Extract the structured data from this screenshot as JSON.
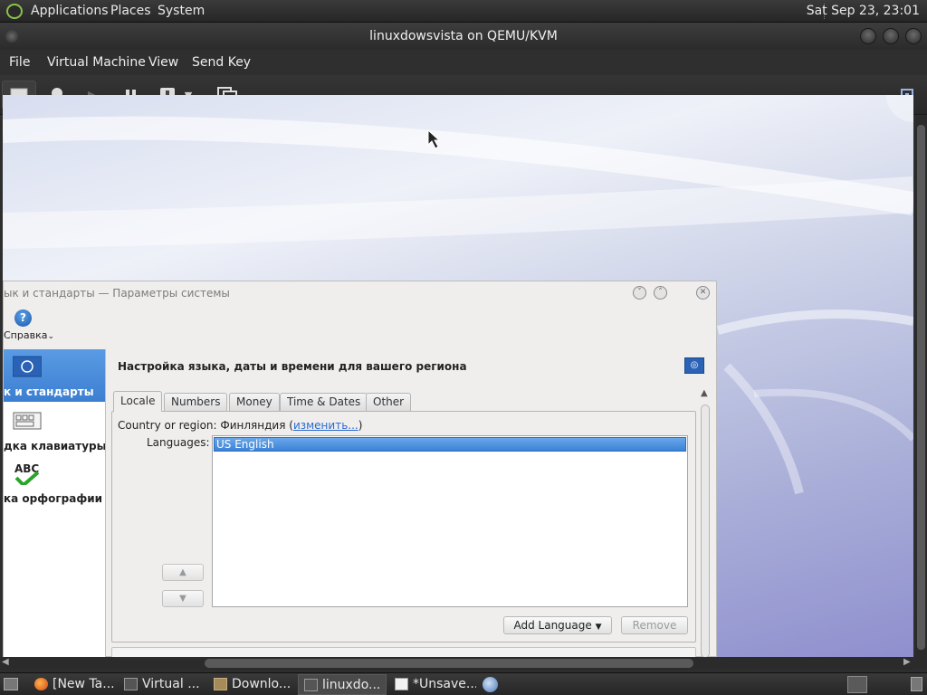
{
  "top_panel": {
    "applications": "Applications",
    "places": "Places",
    "system": "System",
    "clock": "Sat Sep 23, 23:01"
  },
  "vm_window": {
    "title": "linuxdowsvista on QEMU/KVM",
    "menu": [
      "File",
      "Virtual Machine",
      "View",
      "Send Key"
    ],
    "toolbar_icons": [
      "console-icon",
      "details-bulb-icon",
      "run-icon",
      "pause-icon",
      "shutdown-icon",
      "dropdown-icon",
      "snapshot-icon",
      "fullscreen-icon"
    ]
  },
  "kde_window": {
    "title": "ык и стандарты — Параметры системы",
    "help_label": "Справка",
    "sidebar": [
      {
        "label": "к и стандарты",
        "icon": "flag-icon",
        "selected": true
      },
      {
        "label": "дка клавиатуры",
        "icon": "keyboard-icon",
        "selected": false
      },
      {
        "label": "ка орфографии",
        "icon": "spellcheck-icon",
        "selected": false
      }
    ],
    "heading": "Настройка языка, даты и времени для вашего региона",
    "tabs": [
      "Locale",
      "Numbers",
      "Money",
      "Time & Dates",
      "Other"
    ],
    "active_tab": "Locale",
    "country_label": "Country or region:",
    "country_value": "Финляндия",
    "change_link": "изменить...",
    "languages_label": "Languages:",
    "languages": [
      "US English"
    ],
    "add_language": "Add Language",
    "remove": "Remove"
  },
  "taskbar": [
    {
      "label": "[New Ta...",
      "icon": "firefox-icon",
      "active": false
    },
    {
      "label": "Virtual ...",
      "icon": "virt-manager-icon",
      "active": false
    },
    {
      "label": "Downlo...",
      "icon": "folder-icon",
      "active": false
    },
    {
      "label": "linuxdo...",
      "icon": "vm-console-icon",
      "active": true
    },
    {
      "label": "*Unsave...",
      "icon": "text-editor-icon",
      "active": false
    }
  ]
}
